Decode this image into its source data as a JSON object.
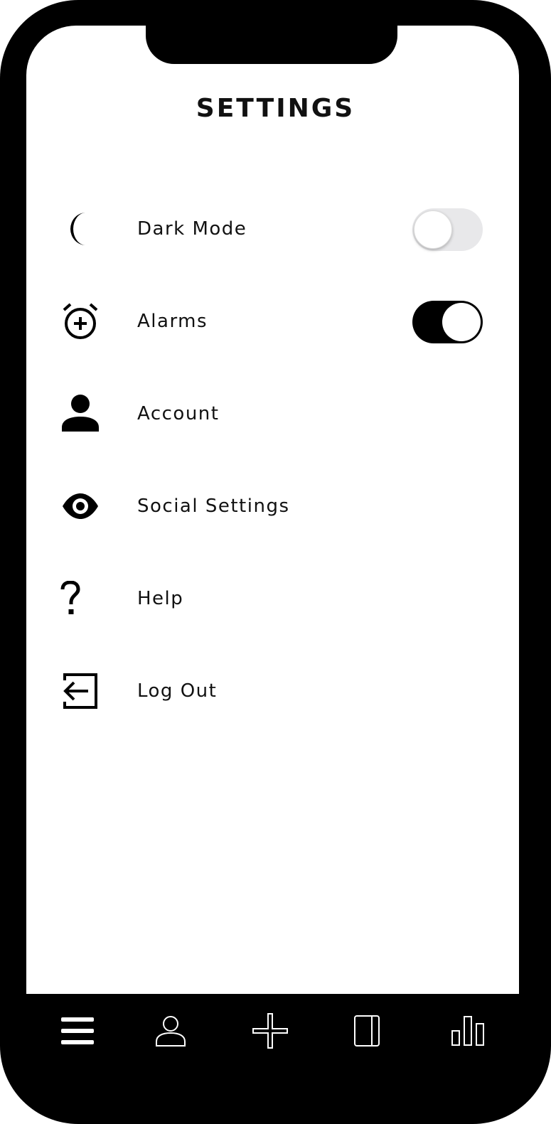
{
  "header": {
    "title": "SETTINGS"
  },
  "settings": [
    {
      "label": "Dark Mode",
      "icon": "moon-icon",
      "toggle": "off"
    },
    {
      "label": "Alarms",
      "icon": "alarm-add-icon",
      "toggle": "on"
    },
    {
      "label": "Account",
      "icon": "person-icon"
    },
    {
      "label": "Social Settings",
      "icon": "eye-icon"
    },
    {
      "label": "Help",
      "icon": "question-icon"
    },
    {
      "label": "Log Out",
      "icon": "logout-icon"
    }
  ],
  "tabbar": {
    "tabs": [
      {
        "icon": "menu-icon"
      },
      {
        "icon": "profile-icon"
      },
      {
        "icon": "add-icon"
      },
      {
        "icon": "journal-icon"
      },
      {
        "icon": "stats-icon"
      }
    ]
  },
  "colors": {
    "frame": "#000000",
    "screen": "#ffffff",
    "toggle_off": "#e8e8ea",
    "toggle_on": "#000000"
  }
}
